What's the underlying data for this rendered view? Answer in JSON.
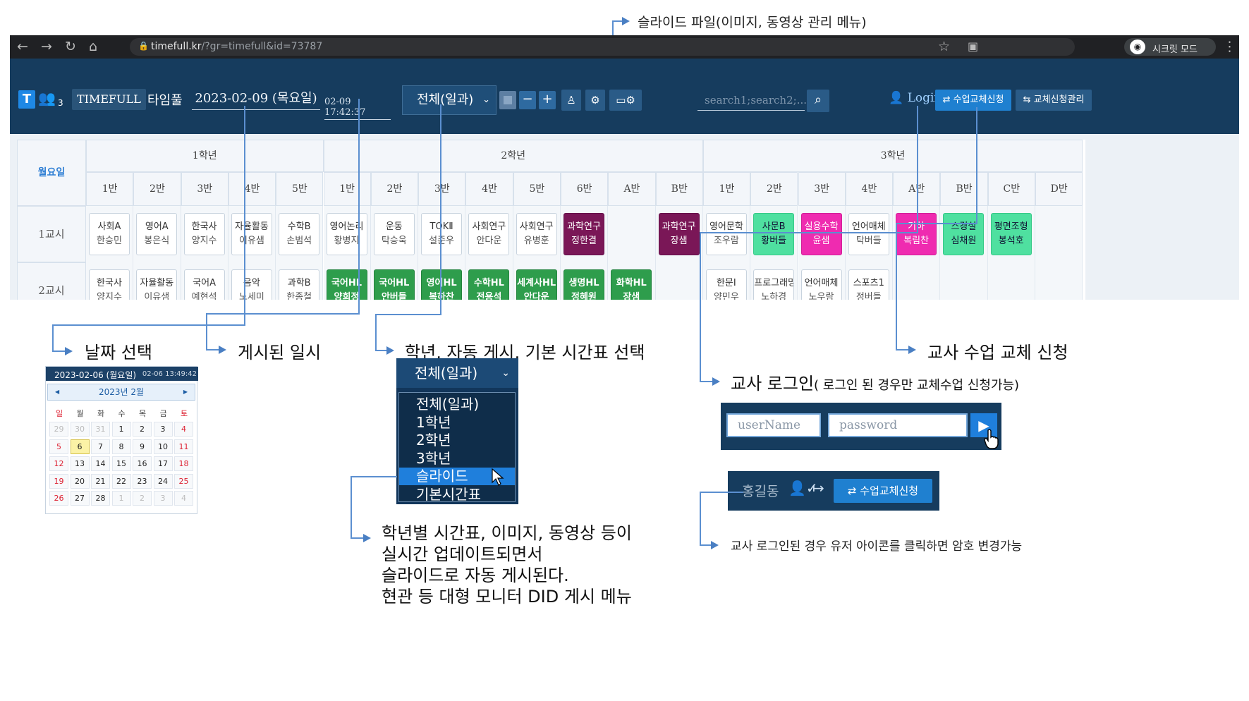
{
  "annotations": {
    "slide_file": "슬라이드 파일(이미지, 동영상 관리 메뉴)",
    "date_select": "날짜 선택",
    "posted_time": "게시된 일시",
    "grade_select": "학년, 자동 게시, 기본 시간표 선택",
    "teacher_swap": "교사 수업 교체 신청",
    "teacher_login": "교사 로그인",
    "teacher_login_note": "( 로그인 된 경우만 교체수업 신청가능)",
    "slide_desc": [
      "학년별 시간표, 이미지, 동영상 등이",
      "실시간 업데이트되면서",
      "슬라이드로 자동 게시된다.",
      "현관 등 대형 모니터 DID 게시 메뉴"
    ],
    "password_note": "교사 로그인된 경우 유저 아이콘를 클릭하면 암호 변경가능"
  },
  "browser": {
    "url_host": "timefull.kr",
    "url_path": "/?gr=timefull&id=73787",
    "incognito_label": "시크릿 모드"
  },
  "header": {
    "t_badge": "T",
    "user_count": "3",
    "brand": "TIMEFULL",
    "brand_kr": "타임풀",
    "date": "2023-02-09 (목요일)",
    "posted": "02-09 17:42:37",
    "grade_select": "전체(일과)",
    "search_placeholder": "search1;search2;...",
    "login": "Login",
    "request_button": "수업교체신청",
    "manage_button": "교체신청관리"
  },
  "table": {
    "day": "월요일",
    "grades": [
      "1학년",
      "2학년",
      "3학년"
    ],
    "classes": [
      "1반",
      "2반",
      "3반",
      "4반",
      "5반",
      "1반",
      "2반",
      "3반",
      "4반",
      "5반",
      "6반",
      "A반",
      "B반",
      "1반",
      "2반",
      "3반",
      "4반",
      "A반",
      "B반",
      "C반",
      "D반"
    ],
    "periods": [
      "1교시",
      "2교시"
    ],
    "rows": [
      [
        {
          "s": "사회A",
          "t": "한승민",
          "c": "white"
        },
        {
          "s": "영어A",
          "t": "봉은식",
          "c": "white"
        },
        {
          "s": "한국사",
          "t": "양지수",
          "c": "white"
        },
        {
          "s": "자율활동",
          "t": "이유샘",
          "c": "white"
        },
        {
          "s": "수학B",
          "t": "손범석",
          "c": "white"
        },
        {
          "s": "영어논리",
          "t": "황병지",
          "c": "white"
        },
        {
          "s": "운동",
          "t": "탁승욱",
          "c": "white"
        },
        {
          "s": "TOKⅡ",
          "t": "설준우",
          "c": "white"
        },
        {
          "s": "사회연구",
          "t": "안다운",
          "c": "white"
        },
        {
          "s": "사회연구",
          "t": "유병훈",
          "c": "white"
        },
        {
          "s": "과학연구",
          "t": "정한결",
          "c": "purple"
        },
        null,
        {
          "s": "과학연구",
          "t": "장샘",
          "c": "purple"
        },
        {
          "s": "영어문학",
          "t": "조우람",
          "c": "white"
        },
        {
          "s": "사문B",
          "t": "황버들",
          "c": "mint"
        },
        {
          "s": "실용수학",
          "t": "윤샘",
          "c": "magenta"
        },
        {
          "s": "언어매체",
          "t": "탁버들",
          "c": "white"
        },
        {
          "s": "기하",
          "t": "복림찬",
          "c": "magenta"
        },
        {
          "s": "스경실",
          "t": "심채원",
          "c": "mint"
        },
        {
          "s": "평면조형",
          "t": "봉석호",
          "c": "mint"
        },
        null
      ],
      [
        {
          "s": "한국사",
          "t": "양지수",
          "c": "white"
        },
        {
          "s": "자율활동",
          "t": "이유샘",
          "c": "white"
        },
        {
          "s": "국어A",
          "t": "예현석",
          "c": "white"
        },
        {
          "s": "음악",
          "t": "노세미",
          "c": "white"
        },
        {
          "s": "과학B",
          "t": "한종철",
          "c": "white"
        },
        {
          "s": "국어HL",
          "t": "양희정",
          "c": "green"
        },
        {
          "s": "국어HL",
          "t": "안버들",
          "c": "green"
        },
        {
          "s": "영어HL",
          "t": "복하찬",
          "c": "green"
        },
        {
          "s": "수학HL",
          "t": "전용석",
          "c": "green"
        },
        {
          "s": "세계사HL",
          "t": "안다운",
          "c": "green"
        },
        {
          "s": "생명HL",
          "t": "정혜원",
          "c": "green"
        },
        {
          "s": "화학HL",
          "t": "장샘",
          "c": "green"
        },
        null,
        {
          "s": "한문Ⅰ",
          "t": "양민우",
          "c": "white"
        },
        {
          "s": "프로그래밍",
          "t": "노하경",
          "c": "white"
        },
        {
          "s": "언어매체",
          "t": "노우람",
          "c": "white"
        },
        {
          "s": "스포츠1",
          "t": "정버들",
          "c": "white"
        },
        null,
        null,
        null,
        null
      ]
    ]
  },
  "calendar": {
    "selected_date": "2023-02-06 (월요일)",
    "time": "02-06 13:49:42",
    "month": "2023년 2월",
    "weekdays": [
      "일",
      "월",
      "화",
      "수",
      "목",
      "금",
      "토"
    ],
    "weeks": [
      [
        "29",
        "30",
        "31",
        "1",
        "2",
        "3",
        "4"
      ],
      [
        "5",
        "6",
        "7",
        "8",
        "9",
        "10",
        "11"
      ],
      [
        "12",
        "13",
        "14",
        "15",
        "16",
        "17",
        "18"
      ],
      [
        "19",
        "20",
        "21",
        "22",
        "23",
        "24",
        "25"
      ],
      [
        "26",
        "27",
        "28",
        "1",
        "2",
        "3",
        "4"
      ]
    ]
  },
  "dropdown": {
    "selected": "전체(일과)",
    "options": [
      "전체(일과)",
      "1학년",
      "2학년",
      "3학년",
      "슬라이드",
      "기본시간표"
    ],
    "highlighted": "슬라이드"
  },
  "login_form": {
    "username_placeholder": "userName",
    "password_placeholder": "password"
  },
  "logged_in": {
    "name": "홍길동",
    "request_button": "수업교체신청"
  }
}
